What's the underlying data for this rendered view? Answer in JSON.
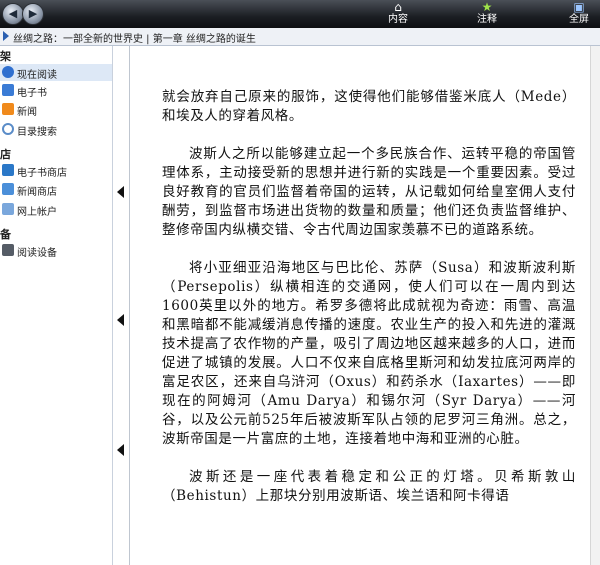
{
  "toolbar": {
    "content_label": "内容",
    "notes_label": "注释",
    "fullscreen_label": "全屏"
  },
  "breadcrumb": "丝绸之路：一部全新的世界史 | 第一章 丝绸之路的诞生",
  "sidebar": {
    "section1": "架",
    "section2": "店",
    "section3": "备",
    "items": [
      {
        "label": "现在阅读",
        "icon": "play-icon"
      },
      {
        "label": "电子书",
        "icon": "book-icon"
      },
      {
        "label": "新闻",
        "icon": "rss-icon"
      },
      {
        "label": "目录搜索",
        "icon": "search-icon"
      },
      {
        "label": "电子书商店",
        "icon": "store-icon"
      },
      {
        "label": "新闻商店",
        "icon": "news-store-icon"
      },
      {
        "label": "网上帐户",
        "icon": "account-icon"
      },
      {
        "label": "阅读设备",
        "icon": "device-icon"
      }
    ]
  },
  "content": {
    "paragraphs": [
      "就会放弃自己原来的服饰，这使得他们能够借鉴米底人（Mede）和埃及人的穿着风格。",
      "波斯人之所以能够建立起一个多民族合作、运转平稳的帝国管理体系，主动接受新的思想并进行新的实践是一个重要因素。受过良好教育的官员们监督着帝国的运转，从记载如何给皇室佣人支付酬劳，到监督市场进出货物的数量和质量；他们还负责监督维护、整修帝国内纵横交错、令古代周边国家羡慕不已的道路系统。",
      "将小亚细亚沿海地区与巴比伦、苏萨（Susa）和波斯波利斯（Persepolis）纵横相连的交通网，使人们可以在一周内到达1600英里以外的地方。希罗多德将此成就视为奇迹：雨雪、高温和黑暗都不能减缓消息传播的速度。农业生产的投入和先进的灌溉技术提高了农作物的产量，吸引了周边地区越来越多的人口，进而促进了城镇的发展。人口不仅来自底格里斯河和幼发拉底河两岸的富足农区，还来自乌浒河（Oxus）和药杀水（Iaxartes）——即现在的阿姆河（Amu Darya）和锡尔河（Syr Darya）——河谷，以及公元前525年后被波斯军队占领的尼罗河三角洲。总之，波斯帝国是一片富庶的土地，连接着地中海和亚洲的心脏。",
      "波斯还是一座代表着稳定和公正的灯塔。贝希斯敦山（Behistun）上那块分别用波斯语、埃兰语和阿卡得语"
    ]
  }
}
